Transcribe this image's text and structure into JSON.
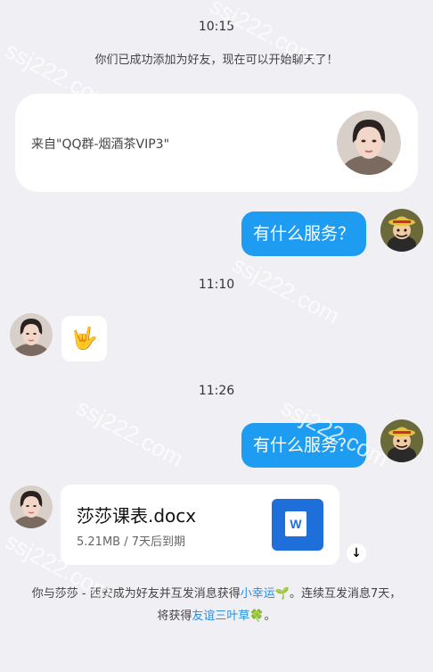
{
  "chat": {
    "time_1": "10:15",
    "system_message": "你们已成功添加为好友，现在可以开始聊天了！",
    "source_label": "来自\"QQ群-烟酒茶VIP3\"",
    "msg_outgoing_1": "有什么服务？",
    "time_2": "11:10",
    "emoji": "🤟",
    "time_3": "11:26",
    "msg_outgoing_2": "有什么服务？",
    "file": {
      "name": "莎莎课表.docx",
      "meta": "5.21MB / 7天后到期",
      "icon_letter": "W"
    },
    "download_glyph": "↓",
    "notice": {
      "part1": "你与莎莎 - 西安成为好友并互发消息获得",
      "link1": "小幸运🌱",
      "part2": "。连续互发消息7天，将获得",
      "link2": "友谊三叶草🍀",
      "part3": "。"
    }
  },
  "watermark": "ssj222.com",
  "colors": {
    "background": "#efeff4",
    "bubble_blue": "#1e9cf2",
    "word_blue": "#1e6fd9",
    "link_blue": "#2a8fe0"
  }
}
